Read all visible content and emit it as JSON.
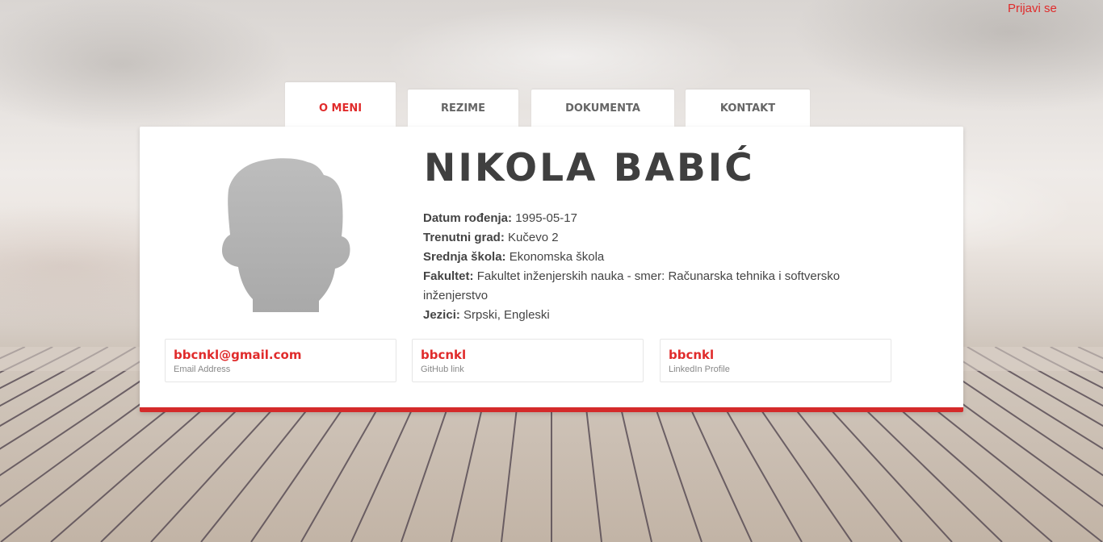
{
  "header": {
    "login_label": "Prijavi se"
  },
  "tabs": [
    {
      "label": "O MENI",
      "active": true
    },
    {
      "label": "REZIME",
      "active": false
    },
    {
      "label": "DOKUMENTA",
      "active": false
    },
    {
      "label": "KONTAKT",
      "active": false
    }
  ],
  "profile": {
    "name": "NIKOLA BABIĆ",
    "fields": [
      {
        "label": "Datum rođenja:",
        "value": "1995-05-17"
      },
      {
        "label": "Trenutni grad:",
        "value": "Kučevo 2"
      },
      {
        "label": "Srednja škola:",
        "value": "Ekonomska škola"
      },
      {
        "label": "Fakultet:",
        "value": "Fakultet inženjerskih nauka - smer: Računarska tehnika i softversko inženjerstvo"
      },
      {
        "label": "Jezici:",
        "value": "Srpski, Engleski"
      }
    ]
  },
  "contacts": [
    {
      "value": "bbcnkl@gmail.com",
      "label": "Email Address"
    },
    {
      "value": "bbcnkl",
      "label": "GitHub link"
    },
    {
      "value": "bbcnkl",
      "label": "LinkedIn Profile"
    }
  ],
  "colors": {
    "accent": "#e02b2b",
    "card_border": "#d42a2a",
    "heading": "#3f3f3f",
    "avatar": "#b3b3b3"
  },
  "icons": {
    "avatar": "person-silhouette-icon"
  }
}
